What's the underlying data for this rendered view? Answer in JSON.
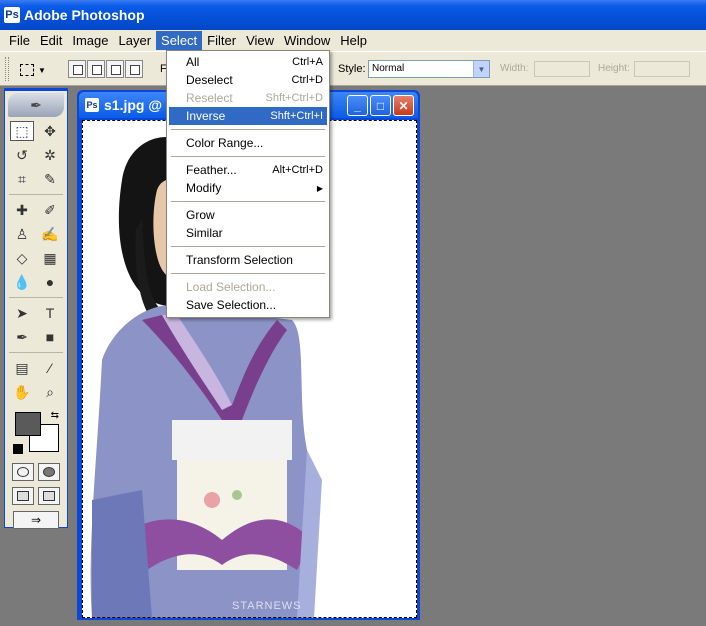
{
  "window": {
    "title": "Adobe Photoshop",
    "icon": "photoshop-icon"
  },
  "menubar": [
    "File",
    "Edit",
    "Image",
    "Layer",
    "Select",
    "Filter",
    "View",
    "Window",
    "Help"
  ],
  "menubar_active": "Select",
  "options": {
    "feather_prefix": "F",
    "style_label": "Style:",
    "style_value": "Normal",
    "width_label": "Width:",
    "height_label": "Height:"
  },
  "document": {
    "title": "s1.jpg @"
  },
  "select_menu": {
    "all": {
      "label": "All",
      "shortcut": "Ctrl+A"
    },
    "deselect": {
      "label": "Deselect",
      "shortcut": "Ctrl+D"
    },
    "reselect": {
      "label": "Reselect",
      "shortcut": "Shft+Ctrl+D"
    },
    "inverse": {
      "label": "Inverse",
      "shortcut": "Shft+Ctrl+I"
    },
    "color_range": {
      "label": "Color Range..."
    },
    "feather": {
      "label": "Feather...",
      "shortcut": "Alt+Ctrl+D"
    },
    "modify": {
      "label": "Modify"
    },
    "grow": {
      "label": "Grow"
    },
    "similar": {
      "label": "Similar"
    },
    "transform_selection": {
      "label": "Transform Selection"
    },
    "load_selection": {
      "label": "Load Selection..."
    },
    "save_selection": {
      "label": "Save Selection..."
    }
  },
  "colors": {
    "foreground": "#5a5a5a",
    "background": "#ffffff",
    "highlight": "#316ac5",
    "titlebar": "#0a5ce8"
  },
  "watermark": "STARNEWS"
}
